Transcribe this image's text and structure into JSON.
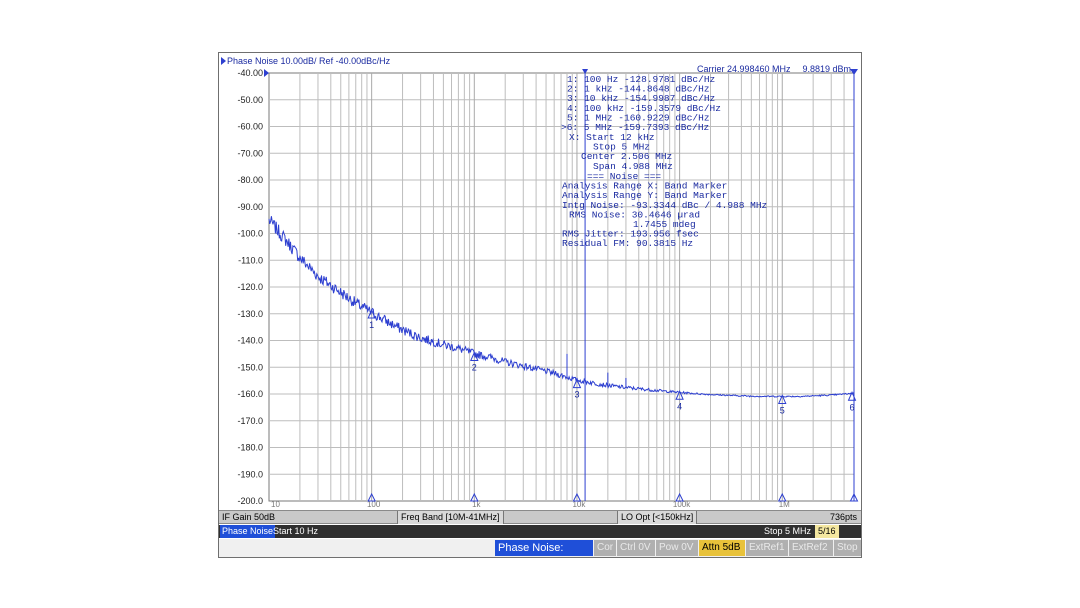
{
  "colors": {
    "trace": "#2d3fd0",
    "grid": "#bdbdbd",
    "text": "#1a2aa0",
    "plot_bg": "#ffffff"
  },
  "header": {
    "title": "Phase Noise 10.00dB/ Ref -40.00dBc/Hz",
    "carrier": "Carrier 24.998460 MHz",
    "power": "9.8819 dBm"
  },
  "marker_table": [
    "1:  100 Hz    -128.9781 dBc/Hz",
    "2:  1 kHz     -144.8648 dBc/Hz",
    "3:  10 kHz    -154.9987 dBc/Hz",
    "4:  100 kHz   -159.3579 dBc/Hz",
    "5:  1 MHz     -160.9229 dBc/Hz",
    ">6:  5 MHz     -159.7393 dBc/Hz"
  ],
  "band_info": [
    "X: Start 12 kHz",
    "Stop 5 MHz",
    "Center 2.506 MHz",
    "Span 4.988 MHz"
  ],
  "noise_info": [
    "=== Noise ===",
    "Analysis Range X: Band Marker",
    "Analysis Range Y: Band Marker",
    "Intg Noise: -93.3344 dBc / 4.988 MHz",
    "RMS Noise: 30.4646 µrad",
    "1.7455 mdeg",
    "RMS Jitter: 193.956 fsec",
    "Residual FM: 90.3815 Hz"
  ],
  "status": {
    "if_gain": "IF Gain 50dB",
    "freq_band": "Freq Band [10M-41MHz]",
    "lo_opt": "LO Opt [<150kHz]",
    "points": "736pts"
  },
  "channel": {
    "label": "Phase Noise",
    "start": "Start 10 Hz",
    "stop": "Stop 5 MHz",
    "fraction": "5/16"
  },
  "softkeys": {
    "meas": "Phase Noise: Meas",
    "cor": "Cor",
    "ctrl": "Ctrl  0V",
    "pow": "Pow  0V",
    "attn": "Attn 5dB",
    "extref1": "ExtRef1",
    "extref2": "ExtRef2",
    "stop": "Stop"
  },
  "chart_data": {
    "type": "line",
    "x_scale": "log",
    "xlim": [
      10,
      5000000
    ],
    "ylim": [
      -200,
      -40
    ],
    "y_ticks": [
      "-40.00",
      "-50.00",
      "-60.00",
      "-70.00",
      "-80.00",
      "-90.00",
      "-100.0",
      "-110.0",
      "-120.0",
      "-130.0",
      "-140.0",
      "-150.0",
      "-160.0",
      "-170.0",
      "-180.0",
      "-190.0",
      "-200.0"
    ],
    "x_tick_labels": [
      {
        "x": 10,
        "label": "10"
      },
      {
        "x": 100,
        "label": "100"
      },
      {
        "x": 1000,
        "label": "1k"
      },
      {
        "x": 10000,
        "label": "10k"
      },
      {
        "x": 100000,
        "label": "100k"
      },
      {
        "x": 1000000,
        "label": "1M"
      }
    ],
    "series": [
      {
        "x": [
          10,
          15,
          20,
          30,
          50,
          70,
          100,
          150,
          200,
          300,
          500,
          700,
          1000,
          1500,
          2000,
          3000,
          5000,
          7000,
          10000,
          15000,
          20000,
          30000,
          50000,
          70000,
          100000,
          150000,
          200000,
          300000,
          500000,
          700000,
          1000000,
          1500000,
          2000000,
          3000000,
          5000000
        ],
        "y": [
          -95,
          -103,
          -109,
          -116,
          -122,
          -126,
          -129.5,
          -133.5,
          -136,
          -139,
          -141.5,
          -143,
          -144.9,
          -146.5,
          -148,
          -149.5,
          -151.5,
          -153,
          -154.8,
          -156,
          -156.8,
          -157.6,
          -158.4,
          -158.9,
          -159.4,
          -159.9,
          -160.2,
          -160.5,
          -160.8,
          -160.9,
          -160.9,
          -160.9,
          -160.7,
          -160.4,
          -159.7
        ]
      }
    ],
    "spurs": [
      {
        "x": 8000,
        "y": -145
      },
      {
        "x": 20000,
        "y": -152
      },
      {
        "x": 30000,
        "y": -154
      }
    ],
    "markers": [
      {
        "label": "1",
        "x": 100,
        "y": -128.9781
      },
      {
        "label": "2",
        "x": 1000,
        "y": -144.8648
      },
      {
        "label": "3",
        "x": 10000,
        "y": -154.9987
      },
      {
        "label": "4",
        "x": 100000,
        "y": -159.3579
      },
      {
        "label": "5",
        "x": 1000000,
        "y": -160.9229
      },
      {
        "label": "6",
        "x": 5000000,
        "y": -159.7393
      }
    ],
    "band_markers": {
      "start": 12000,
      "stop": 5000000
    }
  }
}
